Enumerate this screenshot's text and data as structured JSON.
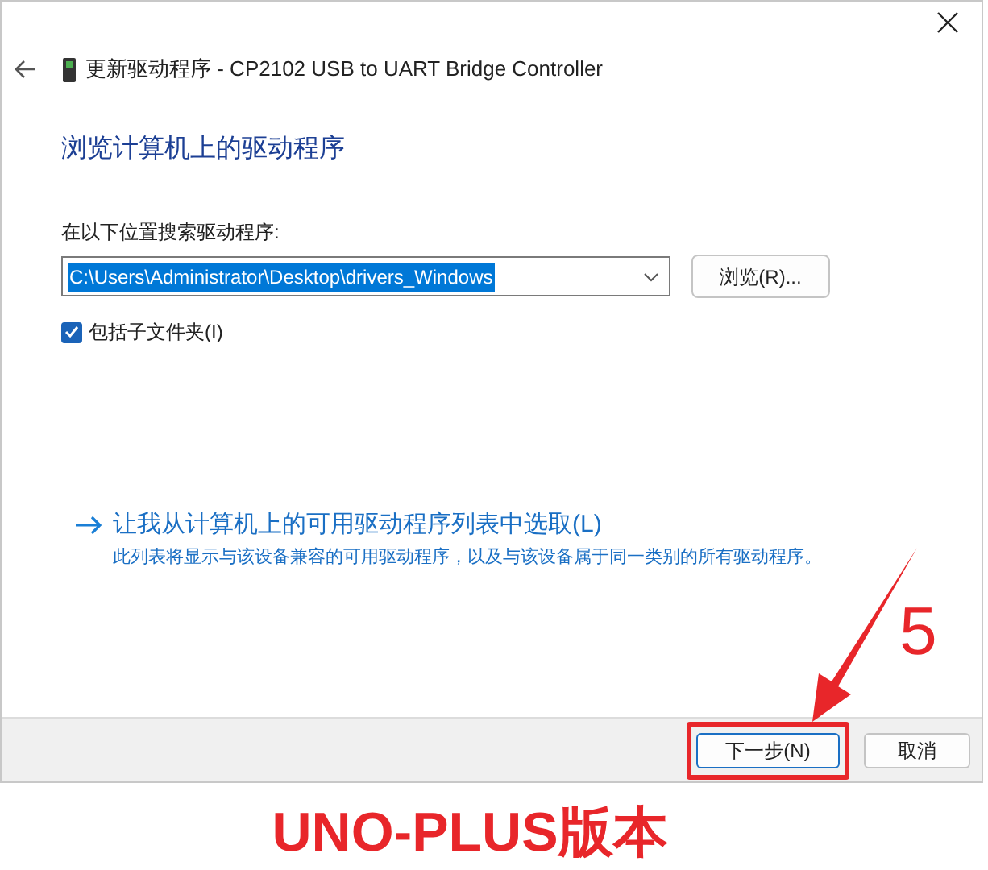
{
  "window": {
    "title": "更新驱动程序 - CP2102 USB to UART Bridge Controller"
  },
  "heading": "浏览计算机上的驱动程序",
  "search_label": "在以下位置搜索驱动程序:",
  "path_field": {
    "value": "C:\\Users\\Administrator\\Desktop\\drivers_Windows",
    "text_selected": true
  },
  "browse_button": "浏览(R)...",
  "include_subfolders": {
    "label": "包括子文件夹(I)",
    "checked": true
  },
  "pick_link": {
    "label": "让我从计算机上的可用驱动程序列表中选取(L)",
    "description": "此列表将显示与该设备兼容的可用驱动程序，以及与该设备属于同一类别的所有驱动程序。"
  },
  "buttons": [
    {
      "label": "下一步(N)",
      "kind": "primary",
      "highlighted": true
    },
    {
      "label": "取消",
      "kind": "default",
      "highlighted": false
    }
  ],
  "annotation": {
    "step": "5",
    "caption": "UNO-PLUS版本"
  }
}
